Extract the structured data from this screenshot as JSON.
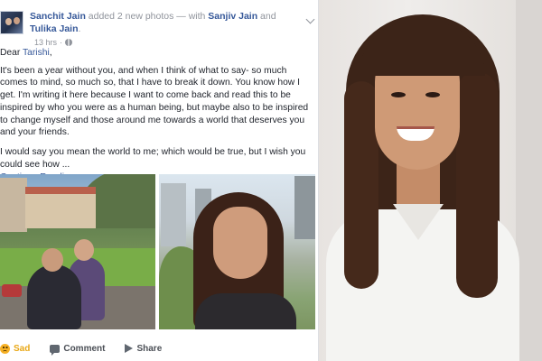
{
  "post": {
    "author": "Sanchit Jain",
    "action_text": " added 2 new photos — with ",
    "tagged_1": "Sanjiv Jain",
    "and_text": " and ",
    "tagged_2": "Tulika Jain",
    "period": ".",
    "timestamp": "13 hrs",
    "separator": "·",
    "greeting_prefix": "Dear ",
    "greeting_name": "Tarishi",
    "greeting_suffix": ",",
    "paragraph_1": "It's been a year without you, and when I think of what to say- so much comes to mind, so much so, that I have to break it down. You know how I get. I'm writing it here because I want to come back and read this to be inspired by who you were as a human being, but maybe also to be inspired to change myself and those around me towards a world that deserves you and your friends.",
    "paragraph_2": "I would say you mean the world to me; which would be true, but I wish you could see how ...",
    "continue_reading": "Continue Reading"
  },
  "actions": {
    "sad": "Sad",
    "comment": "Comment",
    "share": "Share"
  },
  "icons": {
    "privacy": "globe-icon",
    "menu": "chevron-down-icon",
    "reaction": "sad-icon",
    "comment": "comment-icon",
    "share": "share-icon"
  },
  "colors": {
    "link": "#365899",
    "meta": "#90949c",
    "text": "#1d2129",
    "sad": "#f7b125"
  }
}
